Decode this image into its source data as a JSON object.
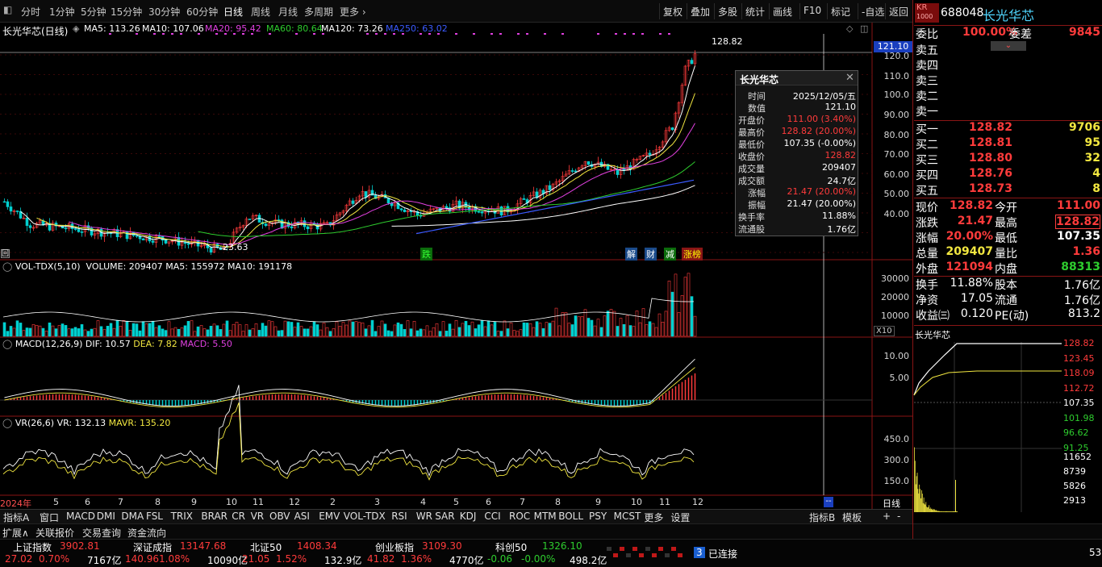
{
  "topbar": {
    "periods": [
      "分时",
      "1分钟",
      "5分钟",
      "15分钟",
      "30分钟",
      "60分钟",
      "日线",
      "周线",
      "月线",
      "多周期",
      "更多 ›"
    ],
    "actions": [
      "复权",
      "叠加",
      "多股",
      "统计",
      "画线",
      "F10",
      "标记",
      "-自选",
      "返回"
    ]
  },
  "chart": {
    "title": "长光华芯(日线)",
    "ma": [
      {
        "label": "MA5: 113.26",
        "color": "#ffffff"
      },
      {
        "label": "MA10: 107.06",
        "color": "#ffffff"
      },
      {
        "label": "MA20: 95.42",
        "color": "#e040e0"
      },
      {
        "label": "MA60: 80.64",
        "color": "#2ecc2e"
      },
      {
        "label": "MA120: 73.26",
        "color": "#ffffff"
      },
      {
        "label": "MA250: 63.02",
        "color": "#3b5bff"
      }
    ],
    "high_label": "128.82",
    "low_label": "23.63",
    "price_tag": "121.10",
    "y_ticks": [
      "120.0",
      "110.0",
      "100.0",
      "90.00",
      "80.00",
      "70.00",
      "60.00",
      "50.00",
      "40.00"
    ],
    "event_markers": [
      "跌",
      "解",
      "财",
      "减",
      "涨榜"
    ],
    "corner_btn": "回"
  },
  "volume": {
    "header": "VOL-TDX(5,10)",
    "values": "VOLUME: 209407  MA5: 155972  MA10: 191178",
    "y_ticks": [
      "30000",
      "20000",
      "10000"
    ],
    "unit": "X10"
  },
  "macd": {
    "header": "MACD(12,26,9)",
    "dif": "DIF: 10.57",
    "dea": "DEA: 7.82",
    "macd": "MACD: 5.50",
    "y_ticks": [
      "10.00",
      "5.00"
    ]
  },
  "vr": {
    "header": "VR(26,6)",
    "vr": "VR: 132.13",
    "mavr": "MAVR: 135.20",
    "y_ticks": [
      "450.0",
      "300.0",
      "150.0"
    ]
  },
  "x_axis": {
    "labels": [
      "2024年",
      "5",
      "6",
      "7",
      "8",
      "9",
      "10",
      "11",
      "12",
      "2",
      "3",
      "4",
      "5",
      "6",
      "7",
      "8",
      "9",
      "10",
      "11",
      "12"
    ],
    "right_label": "日线",
    "right_marker": "--"
  },
  "indicator_tabs": [
    "指标A",
    "窗口",
    "MACD",
    "DMI",
    "DMA",
    "FSL",
    "TRIX",
    "BRAR",
    "CR",
    "VR",
    "OBV",
    "ASI",
    "EMV",
    "VOL-TDX",
    "RSI",
    "WR",
    "SAR",
    "KDJ",
    "CCI",
    "ROC",
    "MTM",
    "BOLL",
    "PSY",
    "MCST",
    "更多",
    "设置"
  ],
  "indicator_right": [
    "指标B",
    "模板",
    "+",
    "-"
  ],
  "sub_tabs": [
    "扩展∧",
    "关联报价",
    "交易查询",
    "资金流向"
  ],
  "tooltip": {
    "title": "长光华芯",
    "rows": [
      {
        "k": "时间",
        "v": "2025/12/05/五",
        "c": "wht"
      },
      {
        "k": "数值",
        "v": "121.10",
        "c": "wht"
      },
      {
        "k": "开盘价",
        "v": "111.00 (3.40%)",
        "c": "red"
      },
      {
        "k": "最高价",
        "v": "128.82 (20.00%)",
        "c": "red"
      },
      {
        "k": "最低价",
        "v": "107.35 (-0.00%)",
        "c": "wht"
      },
      {
        "k": "收盘价",
        "v": "128.82",
        "c": "red"
      },
      {
        "k": "成交量",
        "v": "209407",
        "c": "wht"
      },
      {
        "k": "成交额",
        "v": "24.7亿",
        "c": "wht"
      },
      {
        "k": "涨幅",
        "v": "21.47 (20.00%)",
        "c": "red"
      },
      {
        "k": "振幅",
        "v": "21.47 (20.00%)",
        "c": "wht"
      },
      {
        "k": "换手率",
        "v": "11.88%",
        "c": "wht"
      },
      {
        "k": "流通股",
        "v": "1.76亿",
        "c": "wht"
      }
    ]
  },
  "quote": {
    "badge": "KR",
    "badge2": "1000",
    "code": "688048",
    "name": "长光华芯",
    "weibi_k": "委比",
    "weibi_v": "100.00%",
    "weicha_k": "委差",
    "weicha_v": "9845",
    "sells": [
      "卖五",
      "卖四",
      "卖三",
      "卖二",
      "卖一"
    ],
    "buys": [
      {
        "k": "买一",
        "p": "128.82",
        "q": "9706"
      },
      {
        "k": "买二",
        "p": "128.81",
        "q": "95"
      },
      {
        "k": "买三",
        "p": "128.80",
        "q": "32"
      },
      {
        "k": "买四",
        "p": "128.76",
        "q": "4"
      },
      {
        "k": "买五",
        "p": "128.73",
        "q": "8"
      }
    ],
    "stats": [
      {
        "k1": "现价",
        "v1": "128.82",
        "c1": "red",
        "k2": "今开",
        "v2": "111.00",
        "c2": "red"
      },
      {
        "k1": "涨跌",
        "v1": "21.47",
        "c1": "red",
        "k2": "最高",
        "v2": "128.82",
        "c2": "red"
      },
      {
        "k1": "涨幅",
        "v1": "20.00%",
        "c1": "red",
        "k2": "最低",
        "v2": "107.35",
        "c2": "wht"
      },
      {
        "k1": "总量",
        "v1": "209407",
        "c1": "yel",
        "k2": "量比",
        "v2": "1.36",
        "c2": "red"
      },
      {
        "k1": "外盘",
        "v1": "121094",
        "c1": "red",
        "k2": "内盘",
        "v2": "88313",
        "c2": "grn"
      }
    ],
    "stats2": [
      {
        "k1": "换手",
        "v1": "11.88%",
        "k2": "股本",
        "v2": "1.76亿"
      },
      {
        "k1": "净资",
        "v1": "17.05",
        "k2": "流通",
        "v2": "1.76亿"
      },
      {
        "k1": "收益㈢",
        "v1": "0.120",
        "k2": "PE(动)",
        "v2": "813.2"
      }
    ]
  },
  "mini": {
    "title": "长光华芯",
    "y_ticks": [
      {
        "v": "128.82",
        "c": "red"
      },
      {
        "v": "123.45",
        "c": "red"
      },
      {
        "v": "118.09",
        "c": "red"
      },
      {
        "v": "112.72",
        "c": "red"
      },
      {
        "v": "107.35",
        "c": "wht"
      },
      {
        "v": "101.98",
        "c": "grn"
      },
      {
        "v": "96.62",
        "c": "grn"
      },
      {
        "v": "91.25",
        "c": "grn"
      }
    ],
    "vol_ticks": [
      "11652",
      "8739",
      "5826",
      "2913"
    ]
  },
  "ticker": {
    "items": [
      {
        "name": "上证指数",
        "val": "3902.81",
        "chg": "27.02",
        "pct": "0.70%",
        "amt": "7167亿",
        "c": "red"
      },
      {
        "name": "深证成指",
        "val": "13147.68",
        "chg": "140.96",
        "pct": "1.08%",
        "amt": "10090亿",
        "c": "red"
      },
      {
        "name": "北证50",
        "val": "1408.34",
        "chg": "21.05",
        "pct": "1.52%",
        "amt": "132.9亿",
        "c": "red"
      },
      {
        "name": "创业板指",
        "val": "3109.30",
        "chg": "41.82",
        "pct": "1.36%",
        "amt": "4770亿",
        "c": "red"
      },
      {
        "name": "科创50",
        "val": "1326.10",
        "chg": "-0.06",
        "pct": "-0.00%",
        "amt": "498.2亿",
        "c": "grn"
      }
    ],
    "conn_num": "3",
    "conn": "已连接",
    "corner": "53"
  }
}
